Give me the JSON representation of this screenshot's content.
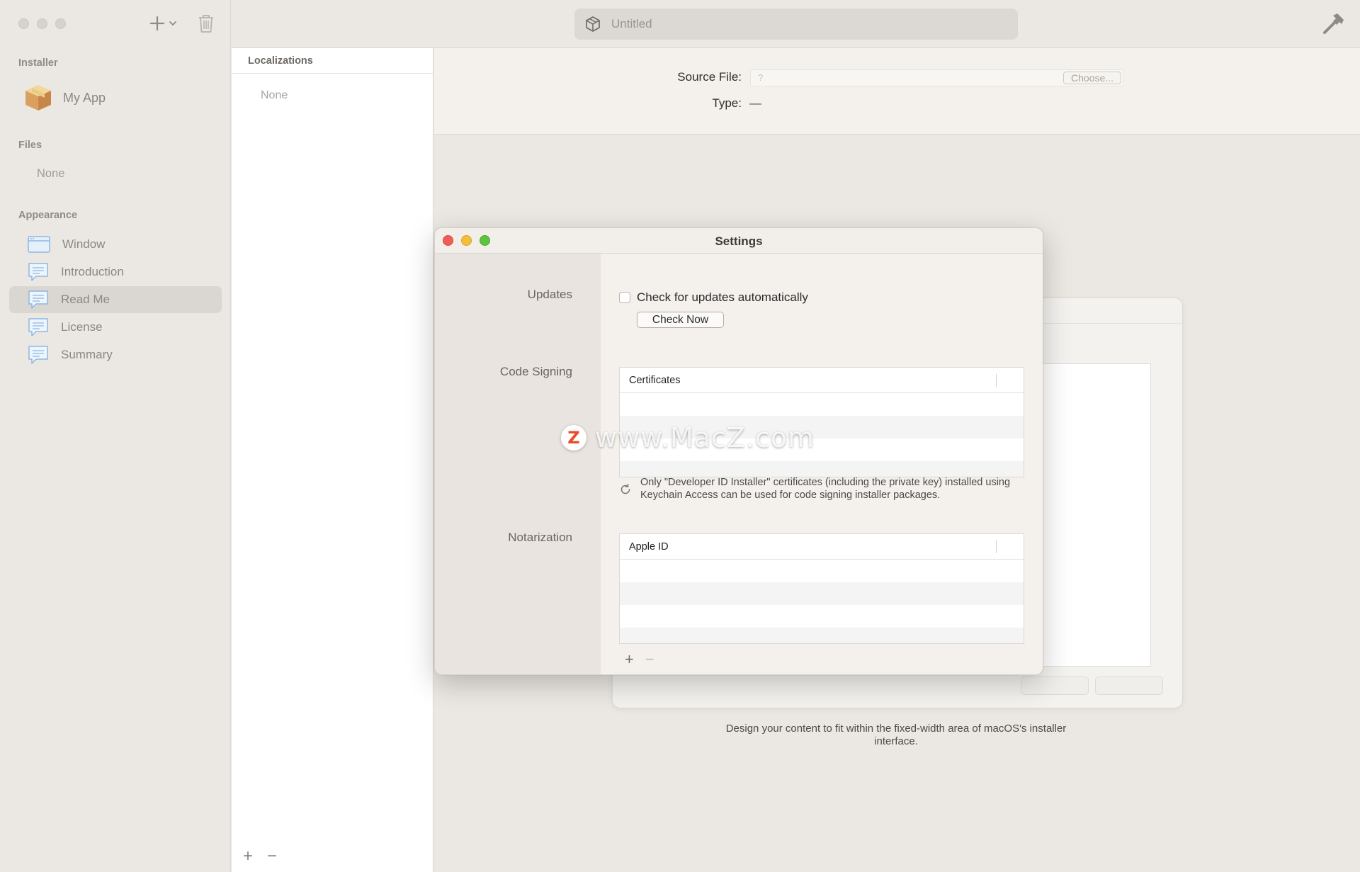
{
  "toolbar": {
    "document_title": "Untitled",
    "icons": [
      "add-icon",
      "chevron-down-icon",
      "trash-icon",
      "package-icon",
      "hammer-icon"
    ]
  },
  "sidebar": {
    "installer_header": "Installer",
    "app_name": "My App",
    "files_header": "Files",
    "files_empty": "None",
    "appearance_header": "Appearance",
    "items": [
      {
        "label": "Window",
        "icon": "window-icon",
        "selected": false
      },
      {
        "label": "Introduction",
        "icon": "speech-bubble-icon",
        "selected": false
      },
      {
        "label": "Read Me",
        "icon": "speech-bubble-icon",
        "selected": true
      },
      {
        "label": "License",
        "icon": "speech-bubble-icon",
        "selected": false
      },
      {
        "label": "Summary",
        "icon": "speech-bubble-icon",
        "selected": false
      }
    ]
  },
  "localizations": {
    "header": "Localizations",
    "empty": "None",
    "add": "+",
    "remove": "−"
  },
  "detail": {
    "source_file_label": "Source File:",
    "source_file_placeholder": "?",
    "choose_button": "Choose...",
    "type_label": "Type:",
    "type_value": "—",
    "design_note": "Design your content to fit within the fixed-width area of macOS's installer interface."
  },
  "settings": {
    "title": "Settings",
    "updates_label": "Updates",
    "auto_update_checkbox": "Check for updates automatically",
    "auto_update_checked": false,
    "check_now_button": "Check Now",
    "code_signing_label": "Code Signing",
    "certificates_header": "Certificates",
    "code_signing_note": "Only \"Developer ID Installer\" certificates (including the private key) installed using Keychain Access can be used for code signing installer packages.",
    "notarization_label": "Notarization",
    "apple_id_header": "Apple ID",
    "add": "+",
    "remove": "−"
  },
  "watermark": {
    "logo_letter": "Z",
    "text": "www.MacZ.com"
  }
}
